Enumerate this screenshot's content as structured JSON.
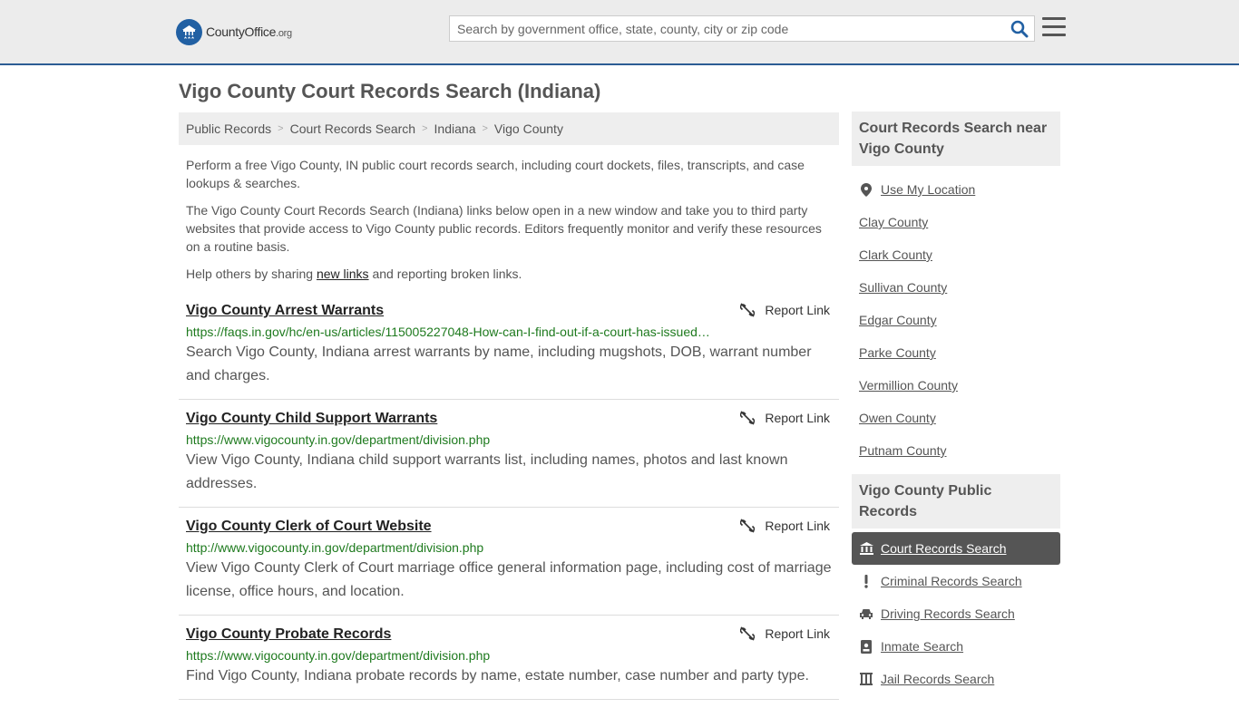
{
  "header": {
    "logo_main": "CountyOffice",
    "logo_domain": ".org",
    "search_placeholder": "Search by government office, state, county, city or zip code"
  },
  "page_title": "Vigo County Court Records Search (Indiana)",
  "breadcrumb": [
    "Public Records",
    "Court Records Search",
    "Indiana",
    "Vigo County"
  ],
  "intro": {
    "p1": "Perform a free Vigo County, IN public court records search, including court dockets, files, transcripts, and case lookups & searches.",
    "p2": "The Vigo County Court Records Search (Indiana) links below open in a new window and take you to third party websites that provide access to Vigo County public records. Editors frequently monitor and verify these resources on a routine basis.",
    "p3_before": "Help others by sharing ",
    "p3_link": "new links",
    "p3_after": " and reporting broken links."
  },
  "report_label": "Report Link",
  "results": [
    {
      "title": "Vigo County Arrest Warrants",
      "url": "https://faqs.in.gov/hc/en-us/articles/115005227048-How-can-I-find-out-if-a-court-has-issued…",
      "desc": "Search Vigo County, Indiana arrest warrants by name, including mugshots, DOB, warrant number and charges."
    },
    {
      "title": "Vigo County Child Support Warrants",
      "url": "https://www.vigocounty.in.gov/department/division.php",
      "desc": "View Vigo County, Indiana child support warrants list, including names, photos and last known addresses."
    },
    {
      "title": "Vigo County Clerk of Court Website",
      "url": "http://www.vigocounty.in.gov/department/division.php",
      "desc": "View Vigo County Clerk of Court marriage office general information page, including cost of marriage license, office hours, and location."
    },
    {
      "title": "Vigo County Probate Records",
      "url": "https://www.vigocounty.in.gov/department/division.php",
      "desc": "Find Vigo County, Indiana probate records by name, estate number, case number and party type."
    }
  ],
  "sidebar": {
    "near_title": "Court Records Search near Vigo County",
    "use_location": "Use My Location",
    "nearby": [
      "Clay County",
      "Clark County",
      "Sullivan County",
      "Edgar County",
      "Parke County",
      "Vermillion County",
      "Owen County",
      "Putnam County"
    ],
    "public_title": "Vigo County Public Records",
    "public_items": [
      {
        "label": "Court Records Search",
        "icon": "courthouse-icon",
        "active": true
      },
      {
        "label": "Criminal Records Search",
        "icon": "exclamation-icon",
        "active": false
      },
      {
        "label": "Driving Records Search",
        "icon": "car-icon",
        "active": false
      },
      {
        "label": "Inmate Search",
        "icon": "id-badge-icon",
        "active": false
      },
      {
        "label": "Jail Records Search",
        "icon": "jail-icon",
        "active": false
      }
    ]
  },
  "colors": {
    "brand_blue": "#2160a3",
    "header_border": "#2c5c94",
    "url_green": "#1e7a1e",
    "active_bg": "#555555"
  }
}
